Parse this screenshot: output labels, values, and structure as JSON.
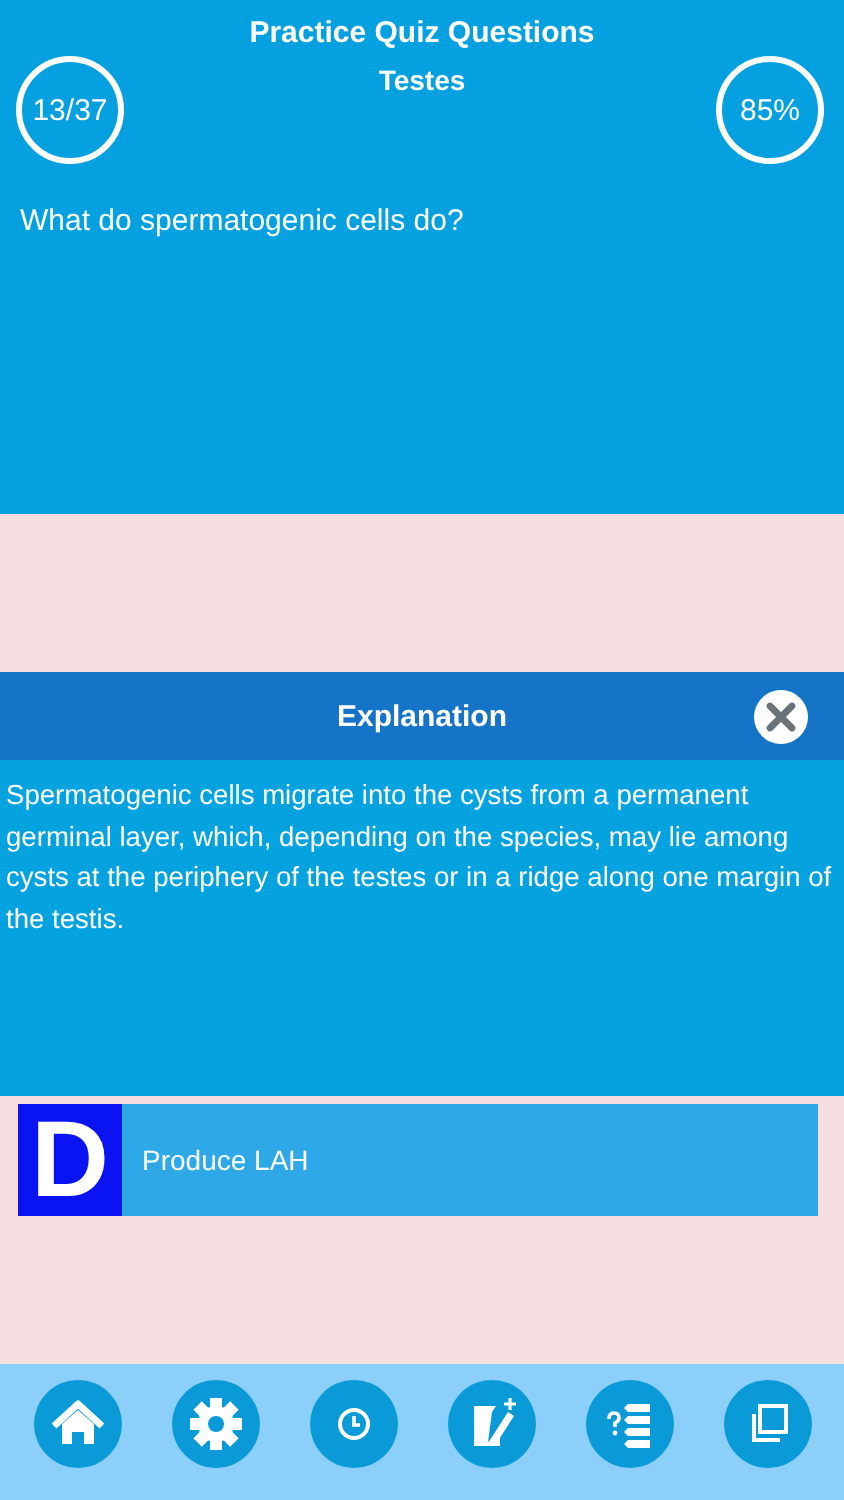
{
  "header": {
    "title": "Practice Quiz Questions",
    "subtitle": "Testes",
    "progress": "13/37",
    "score": "85%"
  },
  "question": "What do spermatogenic cells do?",
  "options": [
    {
      "letter": "D",
      "text": "Produce LAH",
      "color": "#0a14f2"
    }
  ],
  "explanation": {
    "title": "Explanation",
    "text": "Spermatogenic cells migrate into the cysts from a permanent germinal layer, which, depending on the species, may lie among cysts at the periphery of the testes or in a ridge along one margin of the testis."
  },
  "tab_bar": {
    "items": [
      {
        "kind": "home"
      },
      {
        "kind": "settings"
      },
      {
        "kind": "clock"
      },
      {
        "kind": "edit"
      },
      {
        "kind": "list"
      },
      {
        "kind": "copy"
      }
    ]
  }
}
